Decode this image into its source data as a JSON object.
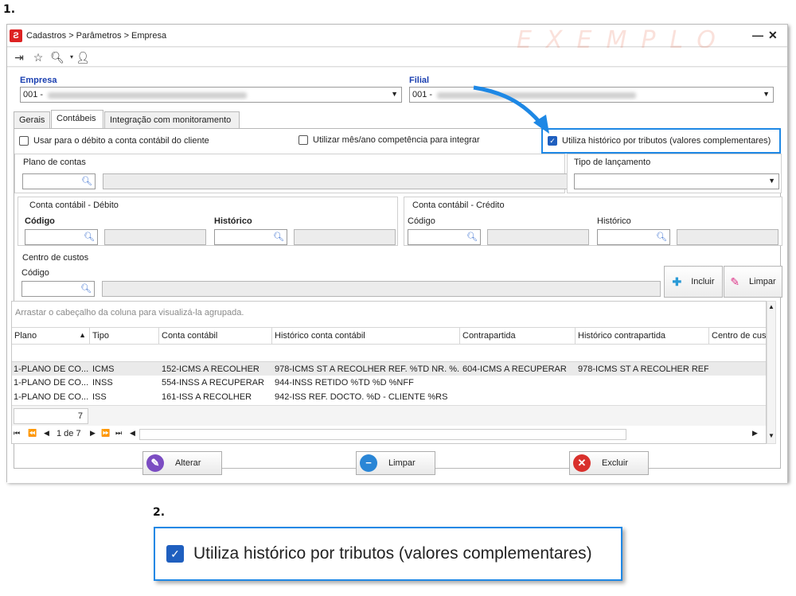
{
  "steps": {
    "one": "1.",
    "two": "2."
  },
  "window": {
    "breadcrumb": "Cadastros > Parâmetros > Empresa",
    "watermark": "EXEMPLO",
    "minimize": "—",
    "close": "✕"
  },
  "toolbar": [
    "exit-icon",
    "favorite-star-icon",
    "search-icon",
    "user-icon"
  ],
  "empresa": {
    "label": "Empresa",
    "value": "001 -"
  },
  "filial": {
    "label": "Filial",
    "value": "001 -"
  },
  "tabs": [
    "Gerais",
    "Contábeis",
    "Integração com monitoramento"
  ],
  "checks": {
    "debito": "Usar para o débito a conta contábil do cliente",
    "competencia": "Utilizar mês/ano competência para integrar",
    "historico": "Utiliza histórico por tributos (valores complementares)"
  },
  "plano": {
    "label": "Plano de contas"
  },
  "tipo_lancamento": {
    "label": "Tipo de lançamento"
  },
  "debito": {
    "title": "Conta contábil - Débito",
    "codigo": "Código",
    "historico": "Histórico"
  },
  "credito": {
    "title": "Conta contábil - Crédito",
    "codigo": "Código",
    "historico": "Histórico"
  },
  "centro": {
    "title": "Centro de custos",
    "codigo": "Código",
    "incluir": "Incluir",
    "limpar": "Limpar"
  },
  "grid": {
    "hint": "Arrastar o cabeçalho da coluna para visualizá-la agrupada.",
    "columns": [
      "Plano",
      "Tipo",
      "Conta contábil",
      "Histórico conta contábil",
      "Contrapartida",
      "Histórico contrapartida",
      "Centro de cus"
    ],
    "rows": [
      [
        "1-PLANO DE CO...",
        "ICMS",
        "152-ICMS A RECOLHER",
        "978-ICMS ST A RECOLHER REF. %TD NR. %...",
        "604-ICMS A RECUPERAR",
        "978-ICMS ST A RECOLHER REF...",
        ""
      ],
      [
        "1-PLANO DE CO...",
        "INSS",
        "554-INSS A RECUPERAR",
        "944-INSS RETIDO %TD %D %NFF",
        "",
        "",
        ""
      ],
      [
        "1-PLANO DE CO...",
        "ISS",
        "161-ISS A RECOLHER",
        "942-ISS REF. DOCTO. %D - CLIENTE %RS",
        "",
        "",
        ""
      ]
    ],
    "count": "7",
    "page": "1 de 7"
  },
  "actions": {
    "alterar": "Alterar",
    "limpar": "Limpar",
    "excluir": "Excluir"
  },
  "zoom_label": "Utiliza histórico por tributos (valores complementares)",
  "colors": {
    "accent": "#1e88e5",
    "label_blue": "#1a3fb0",
    "checkbox": "#1f5fbf"
  }
}
